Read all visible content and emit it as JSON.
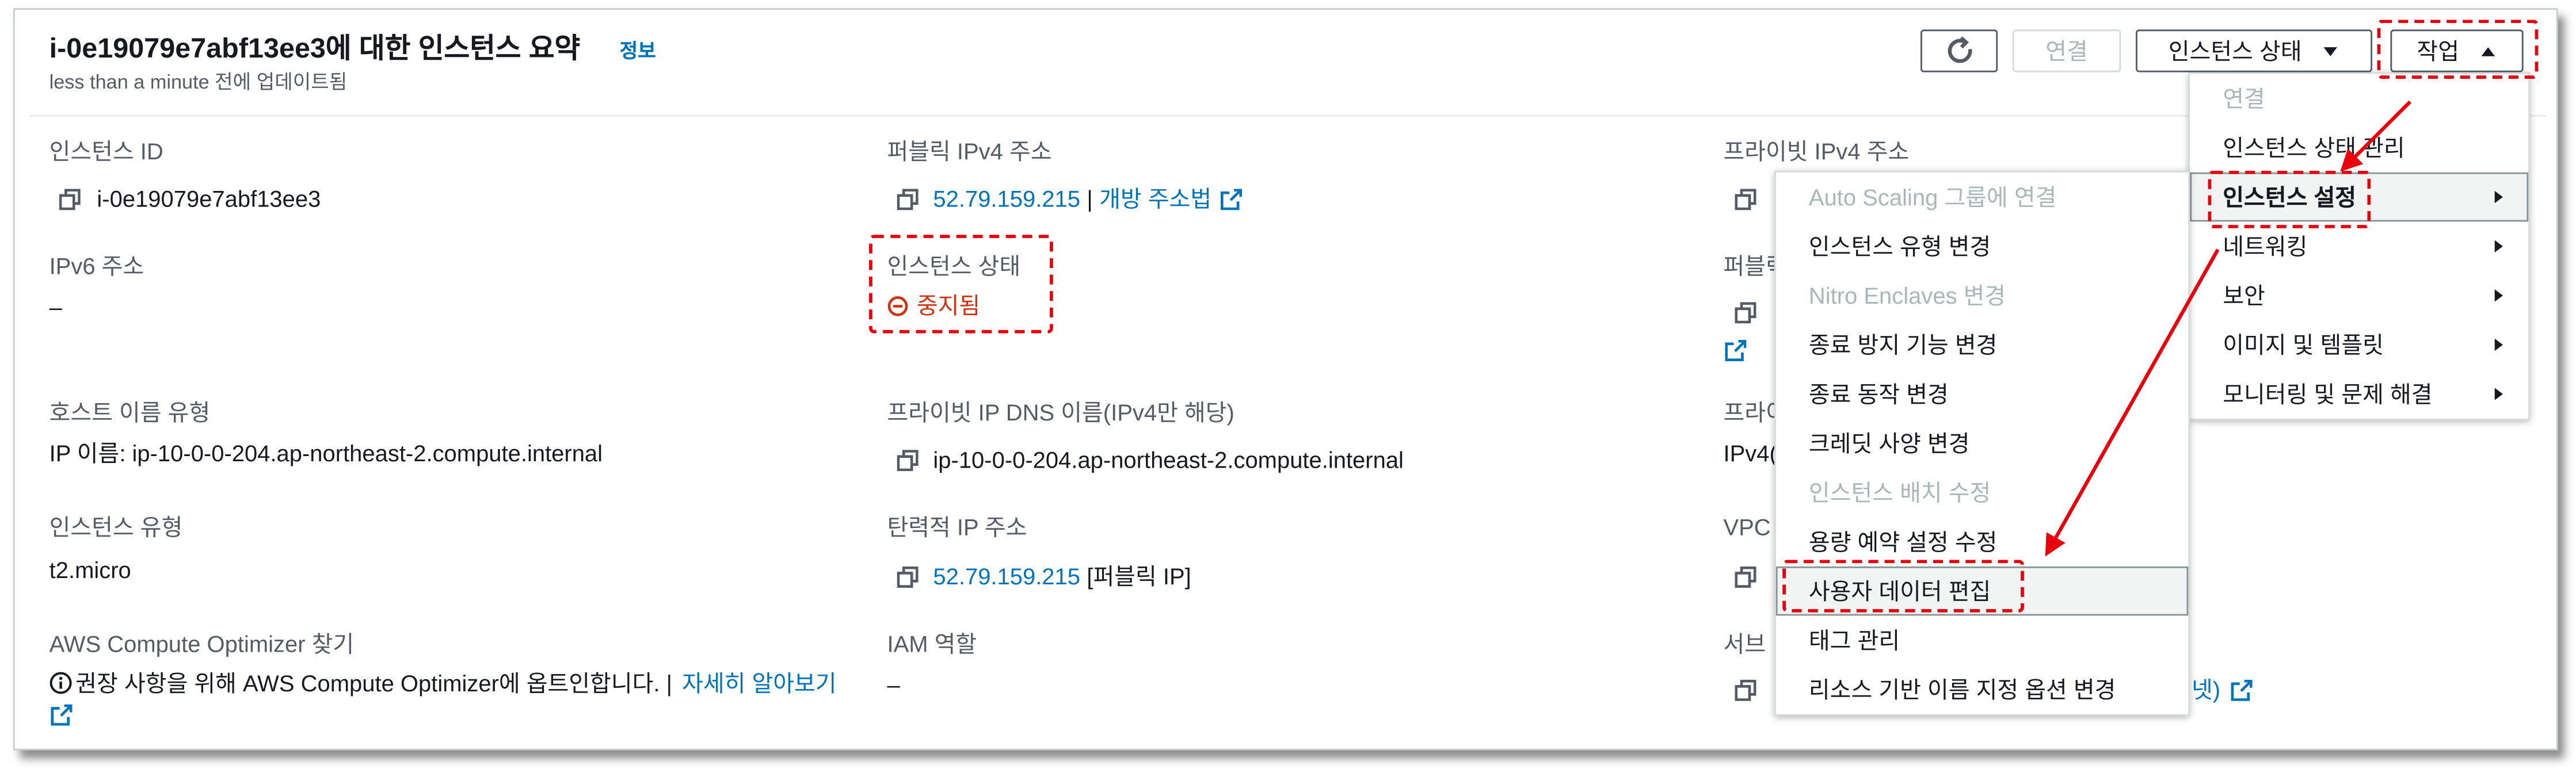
{
  "colors": {
    "link": "#0073bb",
    "status_stopped": "#d13212",
    "annotation": "#e8000b"
  },
  "header": {
    "title": "i-0e19079e7abf13ee3에 대한 인스턴스 요약",
    "info_link": "정보",
    "updated": "less than a minute 전에 업데이트됨",
    "refresh_icon": "refresh-icon",
    "connect_button": "연결",
    "instance_state_button": "인스턴스 상태",
    "actions_button": "작업"
  },
  "summary": {
    "instance_id": {
      "label": "인스턴스 ID",
      "value": "i-0e19079e7abf13ee3"
    },
    "public_ipv4": {
      "label": "퍼블릭 IPv4 주소",
      "value": "52.79.159.215",
      "separator": "|",
      "link": "개방 주소법"
    },
    "private_ipv4": {
      "label": "프라이빗 IPv4 주소"
    },
    "ipv6": {
      "label": "IPv6 주소",
      "value": "–"
    },
    "instance_state": {
      "label": "인스턴스 상태",
      "value": "중지됨",
      "icon": "stopped-icon"
    },
    "hostname_type": {
      "label": "호스트 이름 유형",
      "value": "IP 이름: ip-10-0-0-204.ap-northeast-2.compute.internal"
    },
    "private_dns": {
      "label": "프라이빗 IP DNS 이름(IPv4만 해당)",
      "value": "ip-10-0-0-204.ap-northeast-2.compute.internal"
    },
    "instance_type": {
      "label": "인스턴스 유형",
      "value": "t2.micro"
    },
    "elastic_ip": {
      "label": "탄력적 IP 주소",
      "value": "52.79.159.215",
      "suffix": "[퍼블릭 IP]"
    },
    "compute_optimizer": {
      "label": "AWS Compute Optimizer 찾기",
      "text": "권장 사항을 위해 AWS Compute Optimizer에 옵트인합니다. |",
      "link": "자세히 알아보기"
    },
    "iam_role": {
      "label": "IAM 역할",
      "value": "–"
    },
    "obscured_column": {
      "row2_label": "퍼블릭",
      "row3_label": "프라이",
      "row3_value": "IPv4(",
      "row4_label": "VPC I",
      "row5_label": "서브",
      "row5_value_tail": "넷)"
    }
  },
  "actions_menu": {
    "items": [
      {
        "label": "연결",
        "disabled": true
      },
      {
        "label": "인스턴스 상태 관리"
      },
      {
        "label": "인스턴스 설정",
        "has_submenu": true,
        "expanded": true
      },
      {
        "label": "네트워킹",
        "has_submenu": true
      },
      {
        "label": "보안",
        "has_submenu": true
      },
      {
        "label": "이미지 및 템플릿",
        "has_submenu": true
      },
      {
        "label": "모니터링 및 문제 해결",
        "has_submenu": true
      }
    ]
  },
  "instance_settings_submenu": {
    "items": [
      {
        "label": "Auto Scaling 그룹에 연결",
        "disabled": true
      },
      {
        "label": "인스턴스 유형 변경"
      },
      {
        "label": "Nitro Enclaves 변경",
        "disabled": true
      },
      {
        "label": "종료 방지 기능 변경"
      },
      {
        "label": "종료 동작 변경"
      },
      {
        "label": "크레딧 사양 변경"
      },
      {
        "label": "인스턴스 배치 수정",
        "disabled": true
      },
      {
        "label": "용량 예약 설정 수정"
      },
      {
        "label": "사용자 데이터 편집",
        "highlighted": true
      },
      {
        "label": "태그 관리"
      },
      {
        "label": "리소스 기반 이름 지정 옵션 변경"
      }
    ]
  }
}
